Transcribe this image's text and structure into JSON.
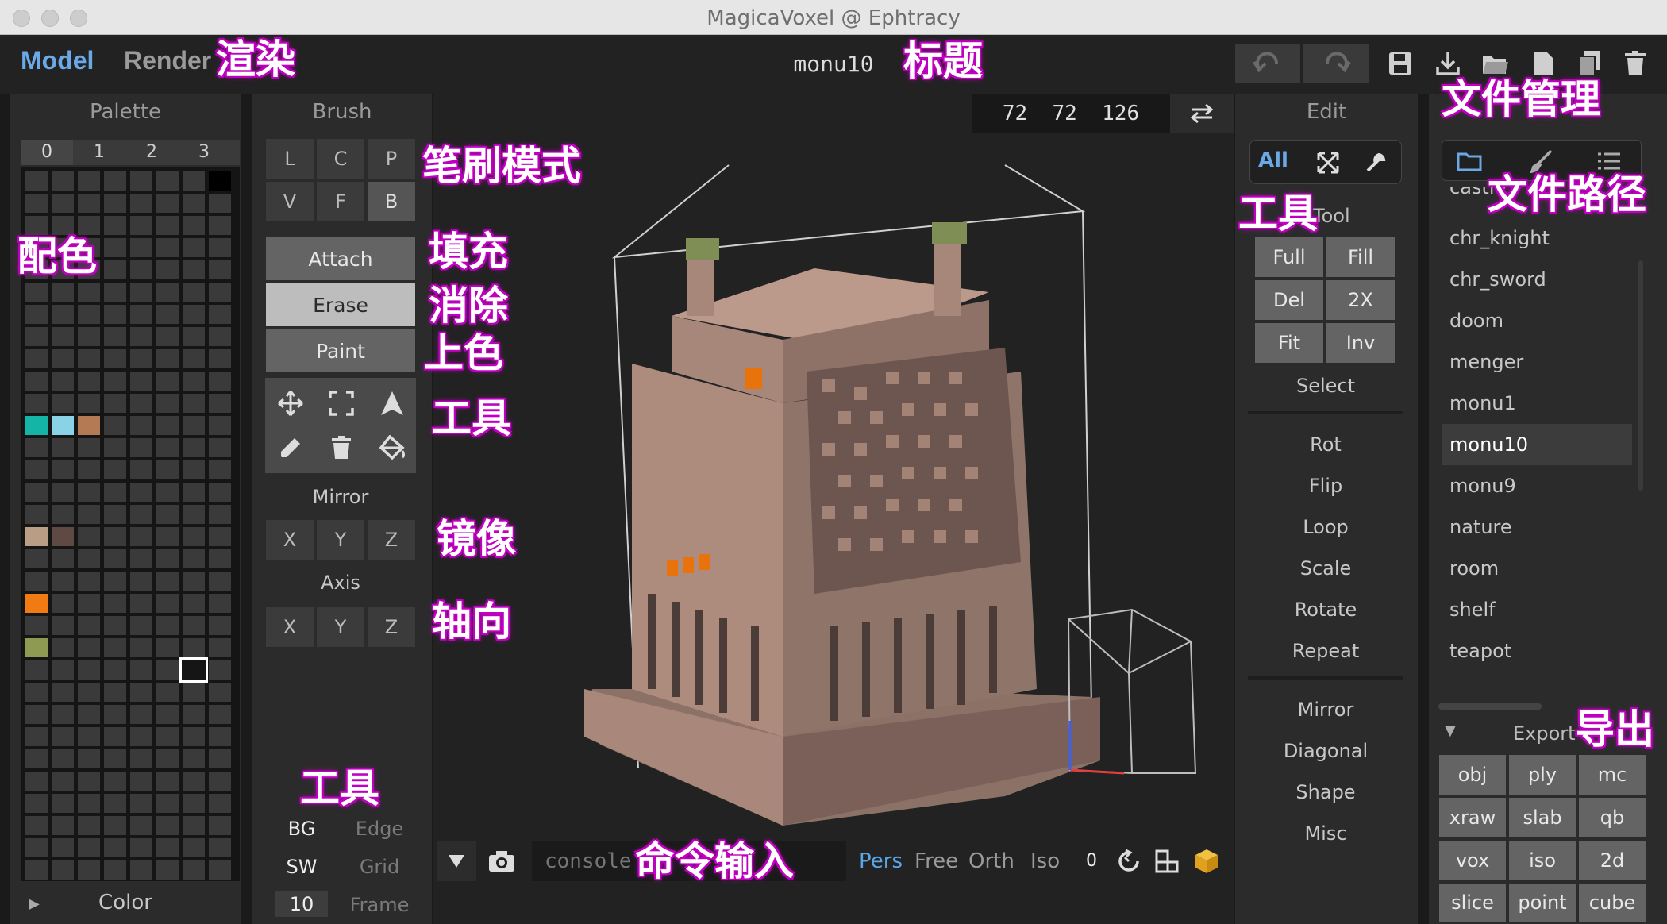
{
  "window": {
    "title": "MagicaVoxel @ Ephtracy"
  },
  "topbar": {
    "mode_model": "Model",
    "mode_render": "Render",
    "file_title": "monu10"
  },
  "annotations": {
    "render": "渲染",
    "title": "标题",
    "file_mgmt": "文件管理",
    "brush_mode": "笔刷模式",
    "fill": "填充",
    "erase": "消除",
    "paint": "上色",
    "tool": "工具",
    "mirror": "镜像",
    "axis": "轴向",
    "palette": "配色",
    "tool2": "工具",
    "tool3": "工具",
    "file_path": "文件路径",
    "export": "导出",
    "command": "命令输入"
  },
  "palette": {
    "title": "Palette",
    "cols": [
      "0",
      "1",
      "2",
      "3"
    ],
    "footer": "Color",
    "swatches": [
      {
        "row": 0,
        "col": 7,
        "color": "#000000"
      },
      {
        "row": 11,
        "col": 0,
        "color": "#14b5a7"
      },
      {
        "row": 11,
        "col": 1,
        "color": "#8ad3e6"
      },
      {
        "row": 11,
        "col": 2,
        "color": "#b37a53"
      },
      {
        "row": 16,
        "col": 0,
        "color": "#b99d84"
      },
      {
        "row": 16,
        "col": 1,
        "color": "#5f4a43"
      },
      {
        "row": 19,
        "col": 0,
        "color": "#f07b12"
      },
      {
        "row": 21,
        "col": 0,
        "color": "#8e9a52"
      }
    ]
  },
  "brush": {
    "title": "Brush",
    "modes": [
      "L",
      "C",
      "P",
      "V",
      "F",
      "B"
    ],
    "actions": [
      "Attach",
      "Erase",
      "Paint"
    ],
    "mirror_label": "Mirror",
    "mirror": [
      "X",
      "Y",
      "Z"
    ],
    "axis_label": "Axis",
    "axis": [
      "X",
      "Y",
      "Z"
    ],
    "bottom": {
      "bg": "BG",
      "edge": "Edge",
      "sw": "SW",
      "grid": "Grid",
      "frame_value": "10",
      "frame": "Frame"
    }
  },
  "viewport": {
    "dims": "72  72  126",
    "console_placeholder": "console",
    "cams": [
      "Pers",
      "Free",
      "Orth",
      "Iso"
    ],
    "zoom": "0"
  },
  "edit": {
    "title": "Edit",
    "tab_all": "All",
    "tool_label": "Tool",
    "tool_buttons": [
      "Full",
      "Fill",
      "Del",
      "2X",
      "Fit",
      "Inv"
    ],
    "select": "Select",
    "group1": [
      "Rot",
      "Flip",
      "Loop",
      "Scale",
      "Rotate",
      "Repeat"
    ],
    "group2": [
      "Mirror",
      "Diagonal",
      "Shape",
      "Misc"
    ]
  },
  "project": {
    "files": [
      "castle",
      "chr_knight",
      "chr_sword",
      "doom",
      "menger",
      "monu1",
      "monu10",
      "monu9",
      "nature",
      "room",
      "shelf",
      "teapot"
    ],
    "selected": "monu10",
    "export_label": "Export",
    "export": [
      "obj",
      "ply",
      "mc",
      "xraw",
      "slab",
      "qb",
      "vox",
      "iso",
      "2d",
      "slice",
      "point",
      "cube"
    ]
  }
}
